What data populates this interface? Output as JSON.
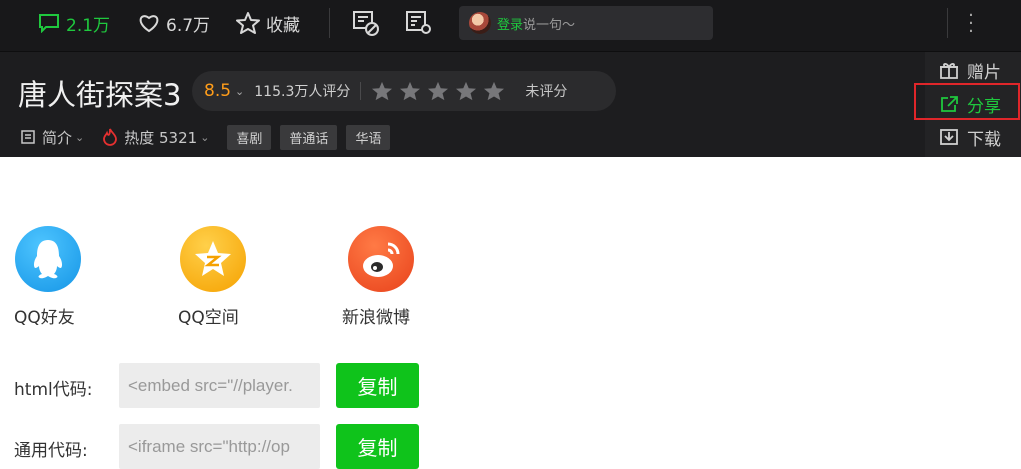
{
  "toolbar": {
    "comments": "2.1万",
    "likes": "6.7万",
    "favorite_label": "收藏",
    "comment_login": "登录",
    "comment_placeholder": "说一句～"
  },
  "movie": {
    "title": "唐人街探案3",
    "score": "8.5",
    "rating_count": "115.3万人评分",
    "unrated": "未评分",
    "intro": "简介",
    "heat": "热度 5321",
    "tags": [
      "喜剧",
      "普通话",
      "华语"
    ]
  },
  "side_menu": {
    "gift": "赠片",
    "share": "分享",
    "download": "下载"
  },
  "share_targets": [
    "QQ好友",
    "QQ空间",
    "新浪微博"
  ],
  "codes": [
    {
      "label": "html代码:",
      "value": "<embed src=\"//player.",
      "button": "复制"
    },
    {
      "label": "通用代码:",
      "value": "<iframe src=\"http://op",
      "button": "复制"
    }
  ],
  "colors": {
    "accent": "#1fc83e",
    "score": "#ff9d1a",
    "highlight": "#e0262a"
  }
}
